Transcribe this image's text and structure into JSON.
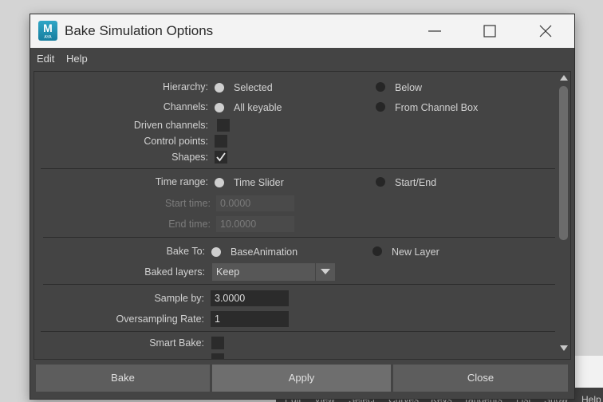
{
  "window": {
    "title": "Bake Simulation Options",
    "app_icon_letter": "M",
    "app_icon_sub": "AYA"
  },
  "menu": [
    "Edit",
    "Help"
  ],
  "form": {
    "hierarchy": {
      "label": "Hierarchy:",
      "options": [
        "Selected",
        "Below"
      ],
      "selected": "Selected"
    },
    "channels": {
      "label": "Channels:",
      "options": [
        "All keyable",
        "From Channel Box"
      ],
      "selected": "All keyable"
    },
    "driven_channels": {
      "label": "Driven channels:",
      "checked": false
    },
    "control_points": {
      "label": "Control points:",
      "checked": false
    },
    "shapes": {
      "label": "Shapes:",
      "checked": true
    },
    "time_range": {
      "label": "Time range:",
      "options": [
        "Time Slider",
        "Start/End"
      ],
      "selected": "Time Slider"
    },
    "start_time": {
      "label": "Start time:",
      "value": "0.0000"
    },
    "end_time": {
      "label": "End time:",
      "value": "10.0000"
    },
    "bake_to": {
      "label": "Bake To:",
      "options": [
        "BaseAnimation",
        "New Layer"
      ],
      "selected": "BaseAnimation"
    },
    "baked_layers": {
      "label": "Baked layers:",
      "value": "Keep"
    },
    "sample_by": {
      "label": "Sample by:",
      "value": "3.0000"
    },
    "oversampling_rate": {
      "label": "Oversampling Rate:",
      "value": "1"
    },
    "smart_bake": {
      "label": "Smart Bake:",
      "checked": false
    }
  },
  "buttons": {
    "bake": "Bake",
    "apply": "Apply",
    "close": "Close"
  },
  "background_menu": [
    "Edit",
    "View",
    "Select",
    "Curves",
    "Keys",
    "Tangents",
    "List",
    "Show",
    "Help"
  ]
}
